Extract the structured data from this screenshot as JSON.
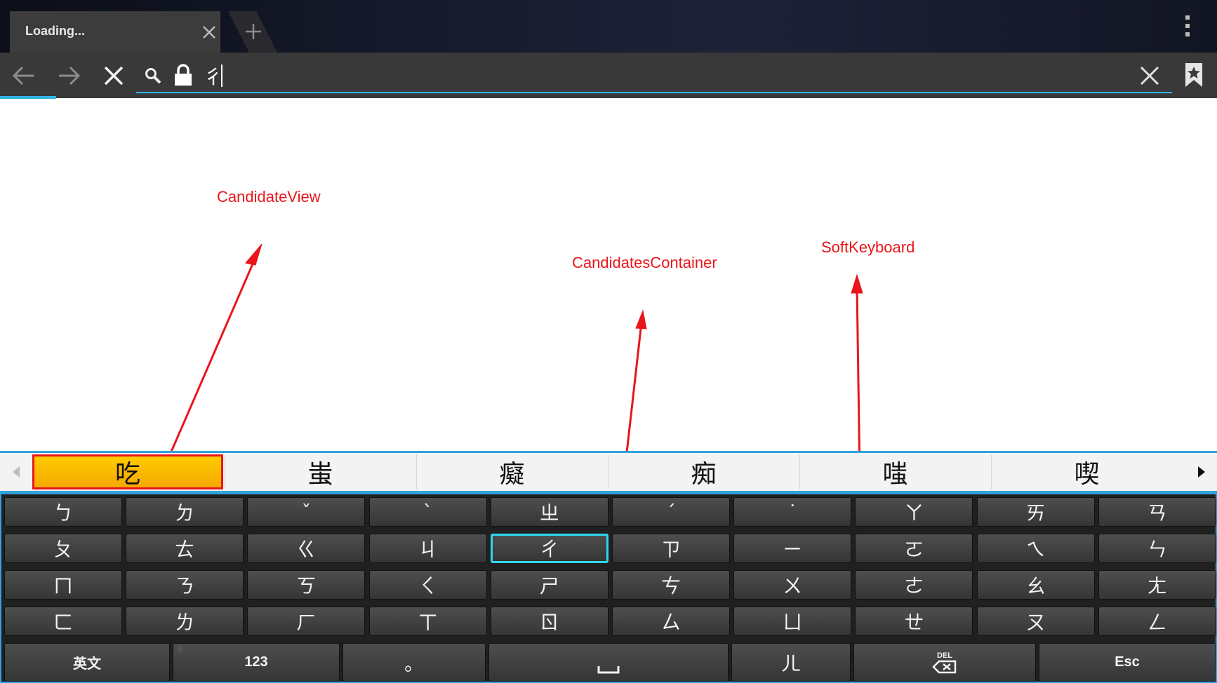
{
  "browser": {
    "tab_title": "Loading...",
    "url_text": "彳"
  },
  "annotations": {
    "candidate_view": "CandidateView",
    "candidates_container": "CandidatesContainer",
    "soft_keyboard": "SoftKeyboard",
    "color": "#e8161b"
  },
  "candidates": [
    "吃",
    "蚩",
    "癡",
    "痴",
    "嗤",
    "喫"
  ],
  "keyboard": {
    "rows": [
      [
        "ㄅ",
        "ㄉ",
        "ˇ",
        "ˋ",
        "ㄓ",
        "ˊ",
        "˙",
        "ㄚ",
        "ㄞ",
        "ㄢ"
      ],
      [
        "ㄆ",
        "ㄊ",
        "ㄍ",
        "ㄐ",
        "ㄔ",
        "ㄗ",
        "ㄧ",
        "ㄛ",
        "ㄟ",
        "ㄣ"
      ],
      [
        "ㄇ",
        "ㄋ",
        "ㄎ",
        "ㄑ",
        "ㄕ",
        "ㄘ",
        "ㄨ",
        "ㄜ",
        "ㄠ",
        "ㄤ"
      ],
      [
        "ㄈ",
        "ㄌ",
        "ㄏ",
        "ㄒ",
        "ㄖ",
        "ㄙ",
        "ㄩ",
        "ㄝ",
        "ㄡ",
        "ㄥ"
      ]
    ],
    "bottom_row": {
      "english": "英文",
      "numbers": "123",
      "period": "。",
      "space": "␣",
      "er": "ㄦ",
      "delete": "DEL",
      "escape": "Esc"
    }
  },
  "colors": {
    "accent": "#33b5e5",
    "candidate_highlight": "#ffcc00",
    "focus_key": "#2fd8f0"
  }
}
